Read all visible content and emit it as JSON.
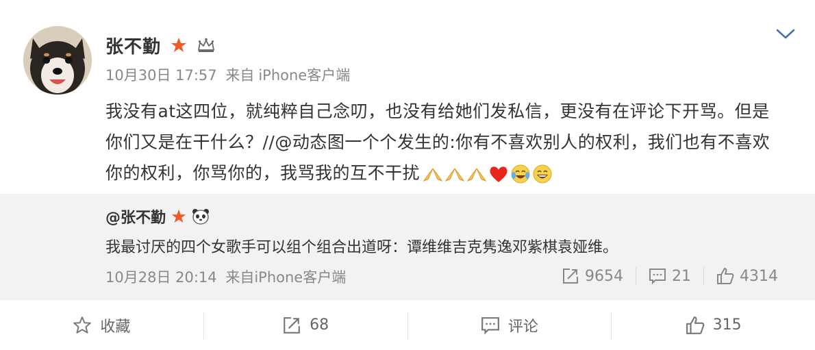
{
  "post": {
    "author": "张不勤",
    "time": "10月30日 17:57",
    "source_prefix": "来自",
    "source": "iPhone客户端",
    "text_part1": "我没有at这四位，就纯粹自己念叨，也没有给她们发私信，更没有在评论下开骂。但是你们又是在干什么？//",
    "mention": "@动态图一个个发生的",
    "text_part2": ":你有不喜欢别人的权利，我们也有不喜欢你的权利，你骂你的，我骂我的互不干扰",
    "emoji_icons": [
      "pray-icon",
      "pray-icon",
      "pray-icon",
      "heart-icon",
      "laugh-cry-icon",
      "laugh-icon"
    ]
  },
  "quote": {
    "author": "@张不勤",
    "text": "我最讨厌的四个女歌手可以组个组合出道呀：谭维维吉克隽逸邓紫棋袁娅维。",
    "time": "10月28日 20:14",
    "source_prefix": "来自",
    "source": "iPhone客户端",
    "reposts": "9654",
    "comments": "21",
    "likes": "4314"
  },
  "actions": {
    "favorite_label": "收藏",
    "repost_count": "68",
    "comment_label": "评论",
    "like_count": "315"
  },
  "colors": {
    "star_badge": "#f05a28",
    "meta_text": "#888888",
    "quote_bg": "#f2f2f2"
  }
}
